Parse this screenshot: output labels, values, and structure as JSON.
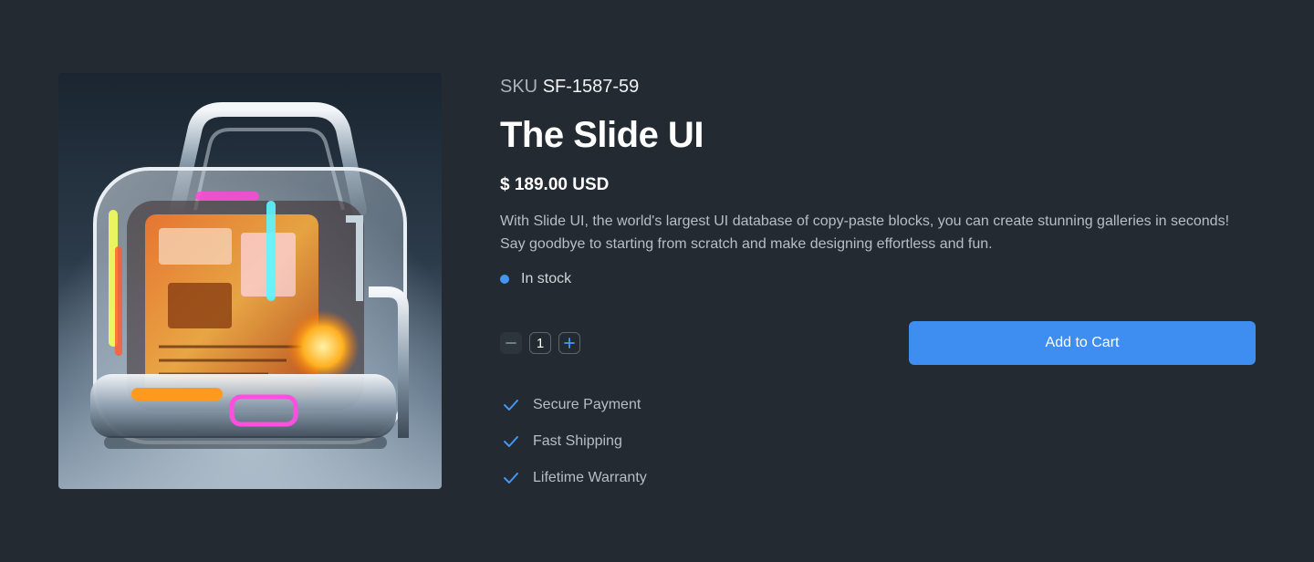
{
  "product": {
    "image_alt": "Transparent glowing machine",
    "sku_label": "SKU",
    "sku": "SF-1587-59",
    "title": "The Slide UI",
    "price": "$ 189.00 USD",
    "description": "With Slide UI, the world's largest UI database of copy-paste blocks, you can create stunning galleries in seconds! Say goodbye to starting from scratch and make designing effortless and fun.",
    "stock_status": "In stock"
  },
  "cart": {
    "quantity": "1",
    "minus_icon": "minus-icon",
    "plus_icon": "plus-icon",
    "add_label": "Add to Cart"
  },
  "features": [
    {
      "label": "Secure Payment",
      "icon": "check-icon"
    },
    {
      "label": "Fast Shipping",
      "icon": "check-icon"
    },
    {
      "label": "Lifetime Warranty",
      "icon": "check-icon"
    }
  ],
  "colors": {
    "background": "#232a31",
    "accent": "#3d8ef0",
    "stock_dot": "#4596f0",
    "muted_text": "#b7bec6"
  }
}
